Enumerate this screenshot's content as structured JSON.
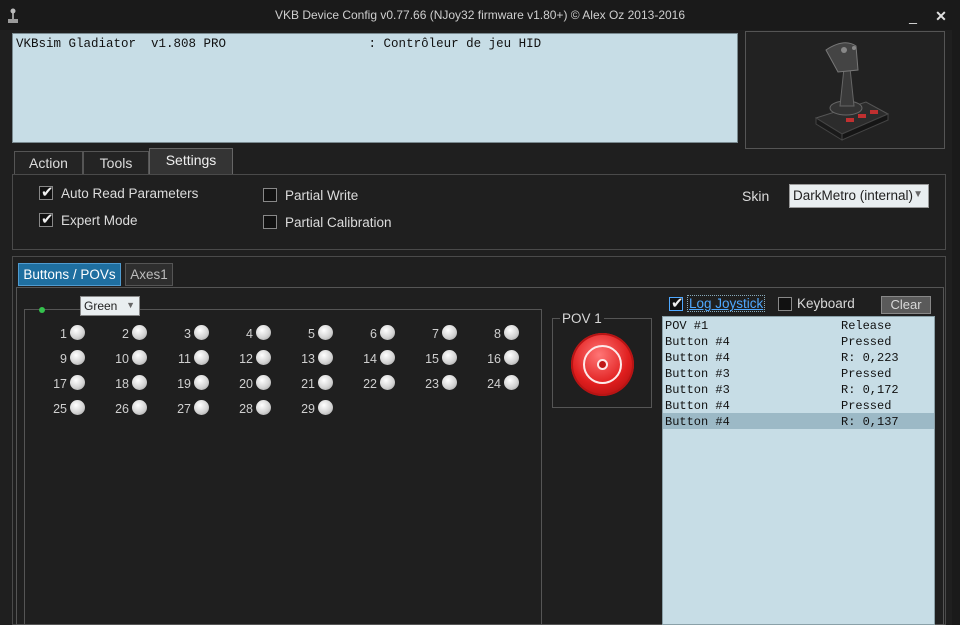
{
  "window": {
    "title": "VKB Device Config v0.77.66 (NJoy32 firmware v1.80+) © Alex Oz 2013-2016",
    "minimize": "_",
    "close": "✕"
  },
  "devices": [
    "VKBsim Gladiator  v1.808 PRO                   : Contrôleur de jeu HID"
  ],
  "tabs": [
    "Action",
    "Tools",
    "Settings"
  ],
  "settings": {
    "auto_read": "Auto Read Parameters",
    "expert_mode": "Expert Mode",
    "partial_write": "Partial Write",
    "partial_calibration": "Partial Calibration",
    "skin_label": "Skin",
    "skin_value": "DarkMetro (internal)"
  },
  "subtabs": [
    "Buttons / POVs",
    "Axes1"
  ],
  "color_select": "Green",
  "buttons": [
    "1",
    "2",
    "3",
    "4",
    "5",
    "6",
    "7",
    "8",
    "9",
    "10",
    "11",
    "12",
    "13",
    "14",
    "15",
    "16",
    "17",
    "18",
    "19",
    "20",
    "21",
    "22",
    "23",
    "24",
    "25",
    "26",
    "27",
    "28",
    "29"
  ],
  "pov": {
    "label": "POV 1"
  },
  "log": {
    "log_joystick": "Log Joystick",
    "keyboard": "Keyboard",
    "clear": "Clear",
    "rows": [
      {
        "name": "POV #1",
        "value": "Release"
      },
      {
        "name": "Button #4",
        "value": "Pressed"
      },
      {
        "name": "Button #4",
        "value": "R: 0,223"
      },
      {
        "name": "Button #3",
        "value": "Pressed"
      },
      {
        "name": "Button #3",
        "value": "R: 0,172"
      },
      {
        "name": "Button #4",
        "value": "Pressed"
      },
      {
        "name": "Button #4",
        "value": "R: 0,137"
      }
    ]
  },
  "colors": {
    "accent": "#1f6fa0",
    "list_bg": "#c7dde6",
    "pov": "#e01e1e",
    "led_active": "#34c24d"
  }
}
